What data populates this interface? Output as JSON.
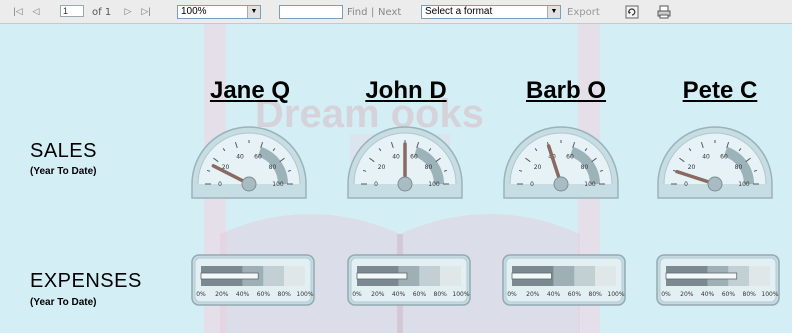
{
  "toolbar": {
    "page_current": "1",
    "page_of": "of 1",
    "zoom": "100%",
    "find_label": "Find",
    "separator": "|",
    "next_label": "Next",
    "format_placeholder": "Select a format",
    "export_label": "Export",
    "icons": [
      "first-page-icon",
      "previous-page-icon",
      "next-page-icon",
      "last-page-icon",
      "refresh-icon",
      "print-icon"
    ]
  },
  "watermark": "Dream ooks",
  "people": [
    {
      "name": "Jane Q",
      "sales_pct": 15,
      "expenses_pct": 55
    },
    {
      "name": "John D",
      "sales_pct": 50,
      "expenses_pct": 48
    },
    {
      "name": "Barb O",
      "sales_pct": 40,
      "expenses_pct": 38
    },
    {
      "name": "Pete C",
      "sales_pct": 10,
      "expenses_pct": 68
    }
  ],
  "rows": {
    "sales": {
      "title": "SALES",
      "subtitle": "(Year To Date)"
    },
    "expenses": {
      "title": "EXPENSES",
      "subtitle": "(Year To Date)"
    }
  },
  "gauge_ticks": [
    "0",
    "20",
    "40",
    "60",
    "80",
    "100"
  ],
  "bar_ticks": [
    "0%",
    "20%",
    "40%",
    "60%",
    "80%",
    "100%"
  ],
  "colors": {
    "background": "#d4eef6",
    "watermark": "#efd5e0",
    "needle": "#8a6a60",
    "bar_fill": "#6f7f86"
  }
}
